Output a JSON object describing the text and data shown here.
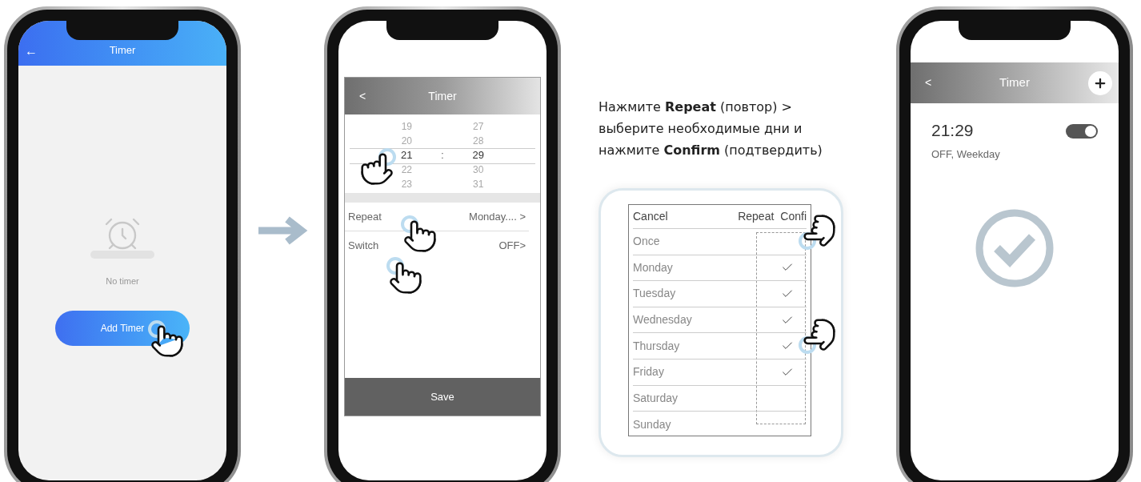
{
  "screen_1": {
    "back": "←",
    "title": "Timer",
    "empty_text": "No timer",
    "button": "Add Timer"
  },
  "screen_2": {
    "back": "<",
    "title": "Timer",
    "hours": [
      {
        "value": "19",
        "selected": false
      },
      {
        "value": "20",
        "selected": false
      },
      {
        "value": "21",
        "selected": true
      },
      {
        "value": "22",
        "selected": false
      },
      {
        "value": "23",
        "selected": false
      }
    ],
    "separator": ":",
    "minutes": [
      {
        "value": "27",
        "selected": false
      },
      {
        "value": "28",
        "selected": false
      },
      {
        "value": "29",
        "selected": true
      },
      {
        "value": "30",
        "selected": false
      },
      {
        "value": "31",
        "selected": false
      }
    ],
    "rows": [
      {
        "label": "Repeat",
        "value": "Monday.... >"
      },
      {
        "label": "Switch",
        "value": "OFF>"
      }
    ],
    "save": "Save"
  },
  "instruction": "Нажмите **Repeat** (повтор) > выберите необходимые дни и нажмите  **Confirm** (подтвердить)",
  "repeat_dialog": {
    "cancel": "Cancel",
    "title": "Repeat",
    "confirm": "Confi",
    "days": [
      {
        "label": "Once",
        "checked": false
      },
      {
        "label": "Monday",
        "checked": true
      },
      {
        "label": "Tuesday",
        "checked": true
      },
      {
        "label": "Wednesday",
        "checked": true
      },
      {
        "label": "Thursday",
        "checked": true
      },
      {
        "label": "Friday",
        "checked": true
      },
      {
        "label": "Saturday",
        "checked": false
      },
      {
        "label": "Sunday",
        "checked": false
      }
    ]
  },
  "screen_3": {
    "back": "<",
    "title": "Timer",
    "timer": {
      "time": "21:29",
      "subtitle": "OFF, Weekday",
      "on": true
    }
  }
}
